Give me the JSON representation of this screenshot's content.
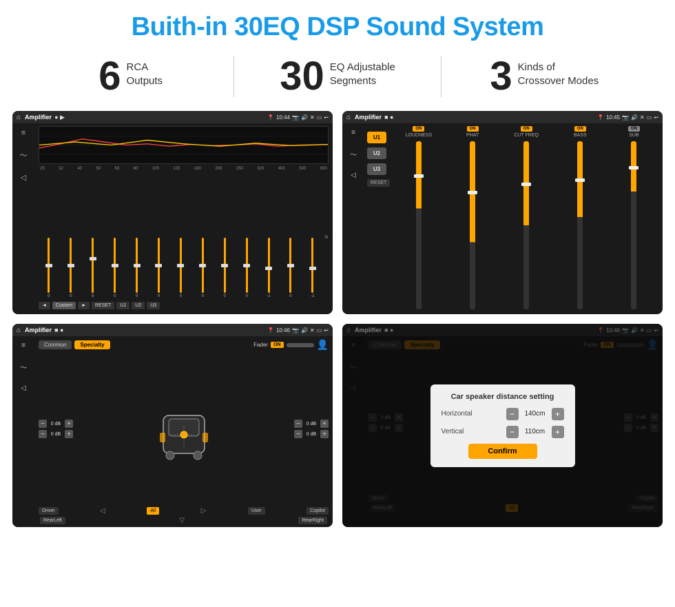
{
  "page": {
    "title": "Buith-in 30EQ DSP Sound System"
  },
  "stats": [
    {
      "number": "6",
      "text_line1": "RCA",
      "text_line2": "Outputs"
    },
    {
      "number": "30",
      "text_line1": "EQ Adjustable",
      "text_line2": "Segments"
    },
    {
      "number": "3",
      "text_line1": "Kinds of",
      "text_line2": "Crossover Modes"
    }
  ],
  "screens": [
    {
      "id": "screen1",
      "status_bar": {
        "title": "Amplifier",
        "time": "10:44"
      },
      "type": "eq",
      "freq_labels": [
        "25",
        "32",
        "40",
        "50",
        "63",
        "80",
        "100",
        "125",
        "160",
        "200",
        "250",
        "320",
        "400",
        "500",
        "630"
      ],
      "controls": [
        "◄",
        "Custom",
        "►",
        "RESET",
        "U1",
        "U2",
        "U3"
      ]
    },
    {
      "id": "screen2",
      "status_bar": {
        "title": "Amplifier",
        "time": "10:45"
      },
      "type": "crossover",
      "presets": [
        "U1",
        "U2",
        "U3"
      ],
      "channels": [
        {
          "label": "LOUDNESS",
          "on": true
        },
        {
          "label": "PHAT",
          "on": true
        },
        {
          "label": "CUT FREQ",
          "on": true
        },
        {
          "label": "BASS",
          "on": true
        },
        {
          "label": "SUB",
          "on": true
        }
      ],
      "reset_label": "RESET"
    },
    {
      "id": "screen3",
      "status_bar": {
        "title": "Amplifier",
        "time": "10:46"
      },
      "type": "speaker",
      "tabs": [
        "Common",
        "Specialty"
      ],
      "fader_label": "Fader",
      "fader_on": "ON",
      "db_values": [
        "0 dB",
        "0 dB",
        "0 dB",
        "0 dB"
      ],
      "bottom_buttons": [
        "Driver",
        "All",
        "User",
        "Copilot",
        "RearLeft",
        "RearRight"
      ]
    },
    {
      "id": "screen4",
      "status_bar": {
        "title": "Amplifier",
        "time": "10:46"
      },
      "type": "speaker_dialog",
      "tabs": [
        "Common",
        "Specialty"
      ],
      "dialog": {
        "title": "Car speaker distance setting",
        "horizontal_label": "Horizontal",
        "horizontal_value": "140cm",
        "vertical_label": "Vertical",
        "vertical_value": "110cm",
        "confirm_label": "Confirm"
      },
      "db_values": [
        "0 dB",
        "0 dB"
      ],
      "bottom_buttons": [
        "Driver",
        "Copilot",
        "RearLeft",
        "RearRight"
      ]
    }
  ]
}
